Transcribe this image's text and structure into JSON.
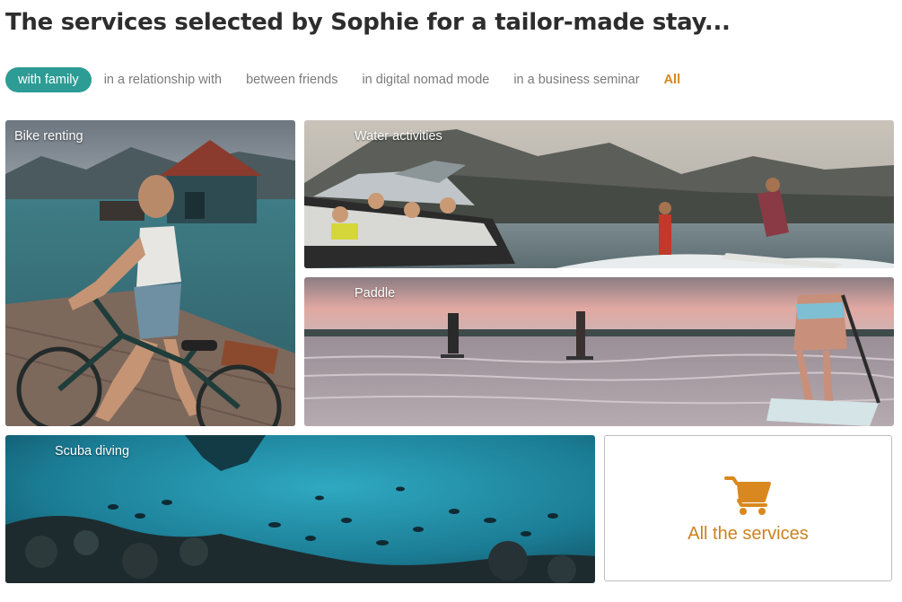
{
  "page": {
    "title": "The services selected by Sophie for a tailor-made stay..."
  },
  "filters": [
    {
      "label": "with family",
      "active": true
    },
    {
      "label": "in a relationship with",
      "active": false
    },
    {
      "label": "between friends",
      "active": false
    },
    {
      "label": "in digital nomad mode",
      "active": false
    },
    {
      "label": "in a business seminar",
      "active": false
    },
    {
      "label": "All",
      "active": false
    }
  ],
  "cards": {
    "bike": {
      "label": "Bike renting"
    },
    "water": {
      "label": "Water activities"
    },
    "paddle": {
      "label": "Paddle"
    },
    "scuba": {
      "label": "Scuba diving"
    },
    "services": {
      "label": "All the services",
      "icon": "cart-icon"
    }
  },
  "colors": {
    "accent_teal": "#2d9c95",
    "accent_orange": "#d9881f",
    "title": "#2d2d2d",
    "filter_text": "#7b7b7b"
  }
}
